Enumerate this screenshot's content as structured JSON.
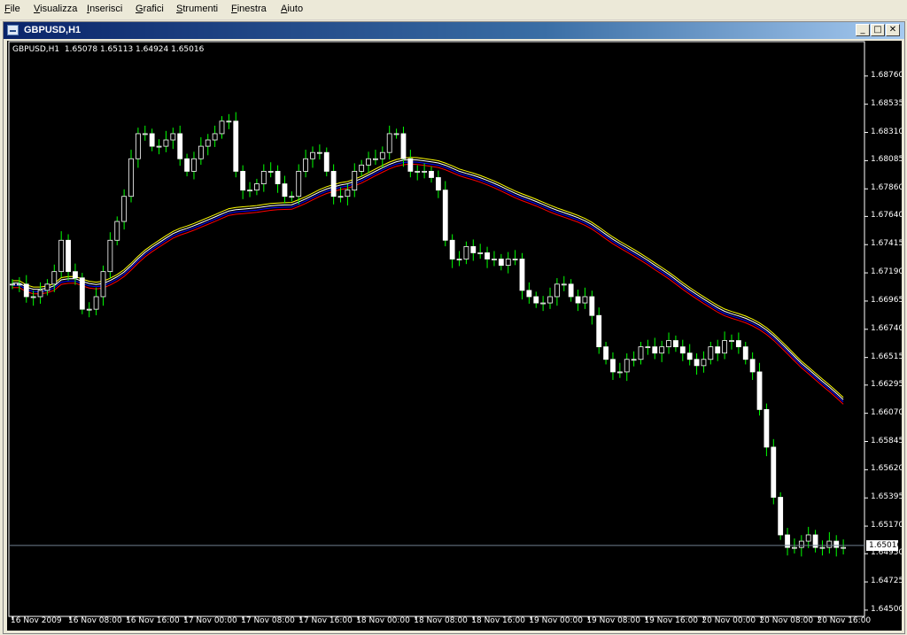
{
  "menu": [
    "File",
    "Visualizza",
    "Inserisci",
    "Grafici",
    "Strumenti",
    "Finestra",
    "Aiuto"
  ],
  "window": {
    "title": "GBPUSD,H1",
    "buttons": {
      "minimize": "_",
      "maximize": "□",
      "close": "✕"
    }
  },
  "ohlc_text": "GBPUSD,H1  1.65078 1.65113 1.64924 1.65016",
  "current_price_label": "1.65016",
  "colors": {
    "background": "#000000",
    "candle": "#ffffff",
    "wick": "#00ff00",
    "price_line": "#708090",
    "ma_lines": [
      "#ff0000",
      "#0000ff",
      "#ffffff",
      "#ffff00"
    ]
  },
  "chart_data": {
    "type": "candlestick",
    "symbol": "GBPUSD",
    "timeframe": "H1",
    "y_ticks": [
      "1.68760",
      "1.68535",
      "1.68310",
      "1.68085",
      "1.67860",
      "1.67640",
      "1.67415",
      "1.67190",
      "1.66965",
      "1.66740",
      "1.66515",
      "1.66295",
      "1.66070",
      "1.65845",
      "1.65620",
      "1.65395",
      "1.65170",
      "1.64950",
      "1.64725",
      "1.64500"
    ],
    "x_ticks": [
      "16 Nov 2009",
      "16 Nov 08:00",
      "16 Nov 16:00",
      "17 Nov 00:00",
      "17 Nov 08:00",
      "17 Nov 16:00",
      "18 Nov 00:00",
      "18 Nov 08:00",
      "18 Nov 16:00",
      "19 Nov 00:00",
      "19 Nov 08:00",
      "19 Nov 16:00",
      "20 Nov 00:00",
      "20 Nov 08:00",
      "20 Nov 16:00"
    ],
    "ylim": [
      1.6445,
      1.689
    ],
    "current_price": 1.65016,
    "series": [
      {
        "values": [
          1.671,
          1.671,
          1.67,
          1.67,
          1.6705,
          1.671,
          1.672,
          1.6745,
          1.672,
          1.6715,
          1.669,
          1.669,
          1.67,
          1.672,
          1.6745,
          1.676,
          1.678,
          1.681,
          1.683,
          1.683,
          1.682,
          1.682,
          1.6825,
          1.683,
          1.681,
          1.68,
          1.681,
          1.682,
          1.6825,
          1.683,
          1.684,
          1.684,
          1.68,
          1.6785,
          1.6785,
          1.679,
          1.68,
          1.68,
          1.679,
          1.678,
          1.678,
          1.68,
          1.681,
          1.6815,
          1.6815,
          1.68,
          1.678,
          1.678,
          1.6785,
          1.68,
          1.6805,
          1.681,
          1.681,
          1.6815,
          1.683,
          1.683,
          1.681,
          1.68,
          1.68,
          1.68,
          1.6795,
          1.6785,
          1.6745,
          1.673,
          1.673,
          1.674,
          1.6735,
          1.6735,
          1.673,
          1.673,
          1.6725,
          1.673,
          1.673,
          1.6705,
          1.67,
          1.6695,
          1.6695,
          1.67,
          1.671,
          1.671,
          1.67,
          1.6695,
          1.67,
          1.6685,
          1.666,
          1.665,
          1.664,
          1.664,
          1.665,
          1.665,
          1.666,
          1.666,
          1.6655,
          1.666,
          1.6665,
          1.666,
          1.6655,
          1.665,
          1.6645,
          1.665,
          1.666,
          1.6655,
          1.6665,
          1.6665,
          1.666,
          1.665,
          1.664,
          1.661,
          1.658,
          1.654,
          1.651,
          1.65,
          1.65,
          1.6505,
          1.651,
          1.65,
          1.65,
          1.6505,
          1.65,
          1.65
        ],
        "name": ""
      }
    ]
  }
}
